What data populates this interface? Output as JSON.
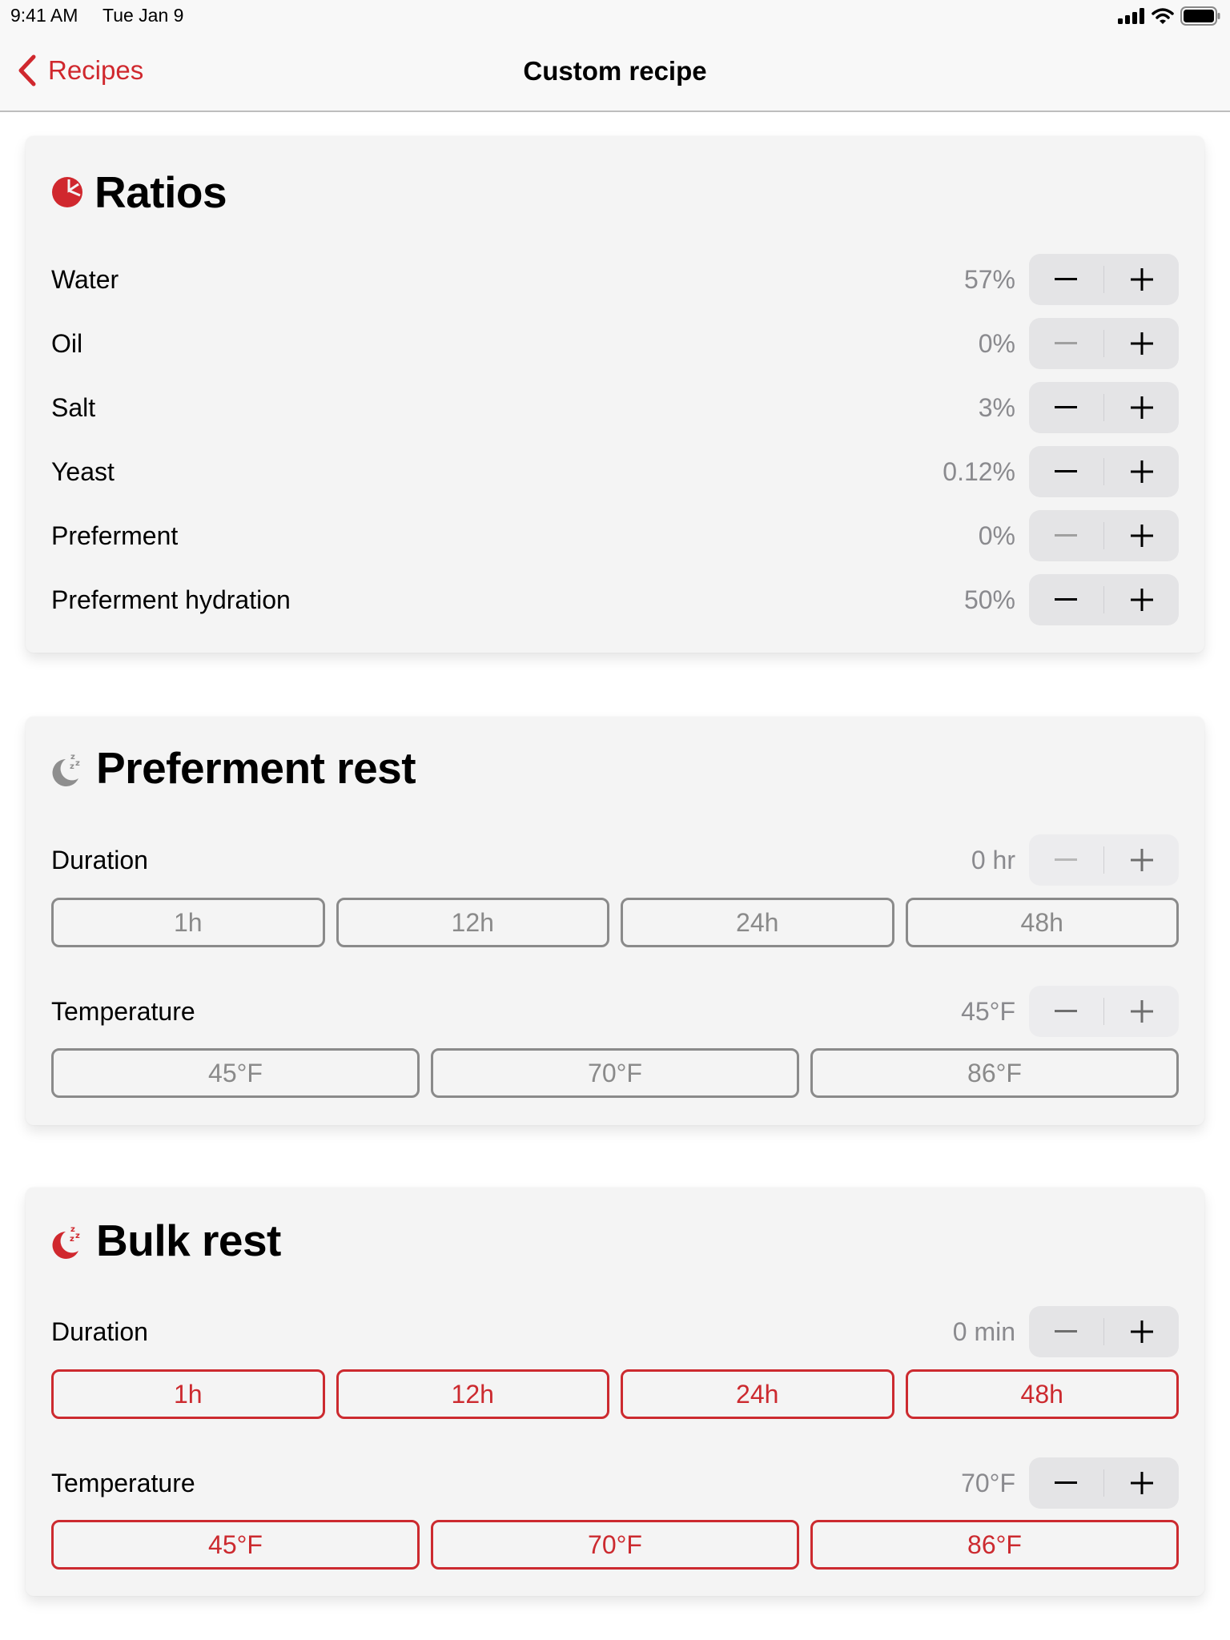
{
  "status_bar": {
    "time": "9:41 AM",
    "date": "Tue Jan 9",
    "icons": [
      "cellular-signal-icon",
      "wifi-icon",
      "battery-icon"
    ]
  },
  "nav": {
    "back_label": "Recipes",
    "title": "Custom recipe"
  },
  "colors": {
    "accent": "#d0282e",
    "value_gray": "#8a8a8e",
    "card_bg": "#f4f4f4"
  },
  "ratios": {
    "title": "Ratios",
    "icon": "pie-chart-icon",
    "rows": [
      {
        "label": "Water",
        "value": "57%",
        "minus_enabled": true
      },
      {
        "label": "Oil",
        "value": "0%",
        "minus_enabled": false
      },
      {
        "label": "Salt",
        "value": "3%",
        "minus_enabled": true
      },
      {
        "label": "Yeast",
        "value": "0.12%",
        "minus_enabled": true
      },
      {
        "label": "Preferment",
        "value": "0%",
        "minus_enabled": false
      },
      {
        "label": "Preferment hydration",
        "value": "50%",
        "minus_enabled": true
      }
    ]
  },
  "preferment_rest": {
    "title": "Preferment rest",
    "icon": "sleep-moon-icon",
    "enabled": false,
    "duration": {
      "label": "Duration",
      "value": "0 hr",
      "presets": [
        "1h",
        "12h",
        "24h",
        "48h"
      ]
    },
    "temperature": {
      "label": "Temperature",
      "value": "45°F",
      "presets": [
        "45°F",
        "70°F",
        "86°F"
      ]
    }
  },
  "bulk_rest": {
    "title": "Bulk rest",
    "icon": "sleep-moon-icon",
    "enabled": true,
    "duration": {
      "label": "Duration",
      "value": "0 min",
      "presets": [
        "1h",
        "12h",
        "24h",
        "48h"
      ]
    },
    "temperature": {
      "label": "Temperature",
      "value": "70°F",
      "presets": [
        "45°F",
        "70°F",
        "86°F"
      ]
    }
  }
}
